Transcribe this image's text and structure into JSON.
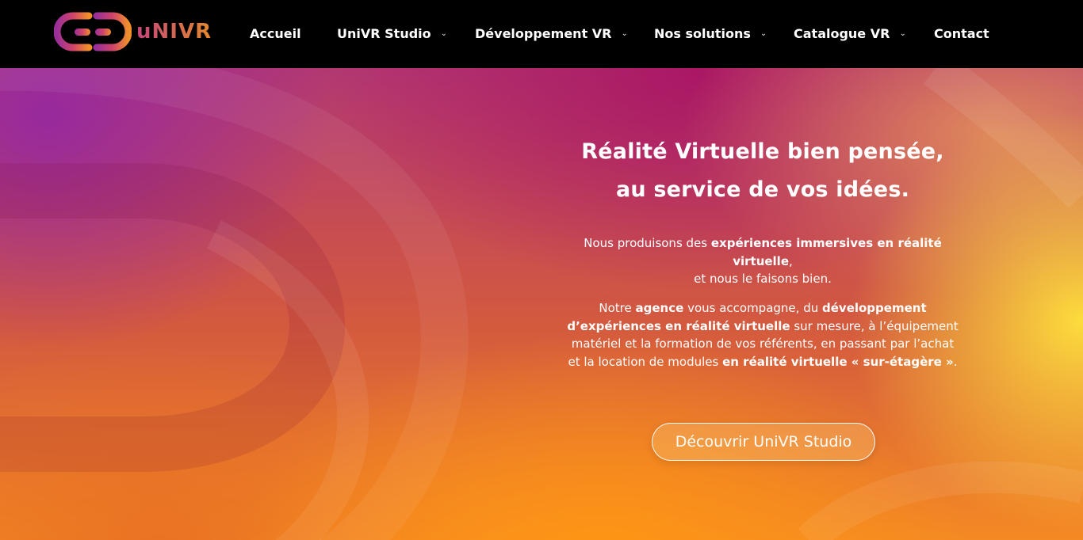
{
  "brand": {
    "name": "uNIVR"
  },
  "nav": {
    "items": [
      {
        "label": "Accueil",
        "has_dropdown": false
      },
      {
        "label": "UniVR Studio",
        "has_dropdown": true
      },
      {
        "label": "Développement VR",
        "has_dropdown": true
      },
      {
        "label": "Nos solutions",
        "has_dropdown": true
      },
      {
        "label": "Catalogue VR",
        "has_dropdown": true
      },
      {
        "label": "Contact",
        "has_dropdown": false
      }
    ],
    "chevron": "⌄"
  },
  "hero": {
    "title_line1": "Réalité Virtuelle bien pensée,",
    "title_line2": "au service de vos idées.",
    "para1": {
      "t1": "Nous produisons des ",
      "b1": "expériences immersives en réalité virtuelle",
      "t2": ",",
      "t3": "et nous le faisons bien."
    },
    "para2": {
      "t1": "Notre ",
      "b1": "agence",
      "t2": " vous accompagne, du ",
      "b2": "développement d’expériences en réalité virtuelle",
      "t3": " sur mesure, à l’équipement matériel et la formation de vos référents, en passant par l’achat et la location de modules ",
      "b3": "en réalité virtuelle « sur-étagère »",
      "t4": "."
    },
    "cta_label": "Découvrir UniVR Studio"
  },
  "colors": {
    "topbar": "#000000",
    "logo_gradient_start": "#c4457a",
    "logo_gradient_end": "#e58a2c",
    "hero_magenta": "#aa1664",
    "hero_orange": "#ff961e",
    "hero_yellow": "#ffe43c"
  },
  "icons": {
    "logo": "vr-headset-logo-icon",
    "dropdown": "chevron-down-icon"
  }
}
